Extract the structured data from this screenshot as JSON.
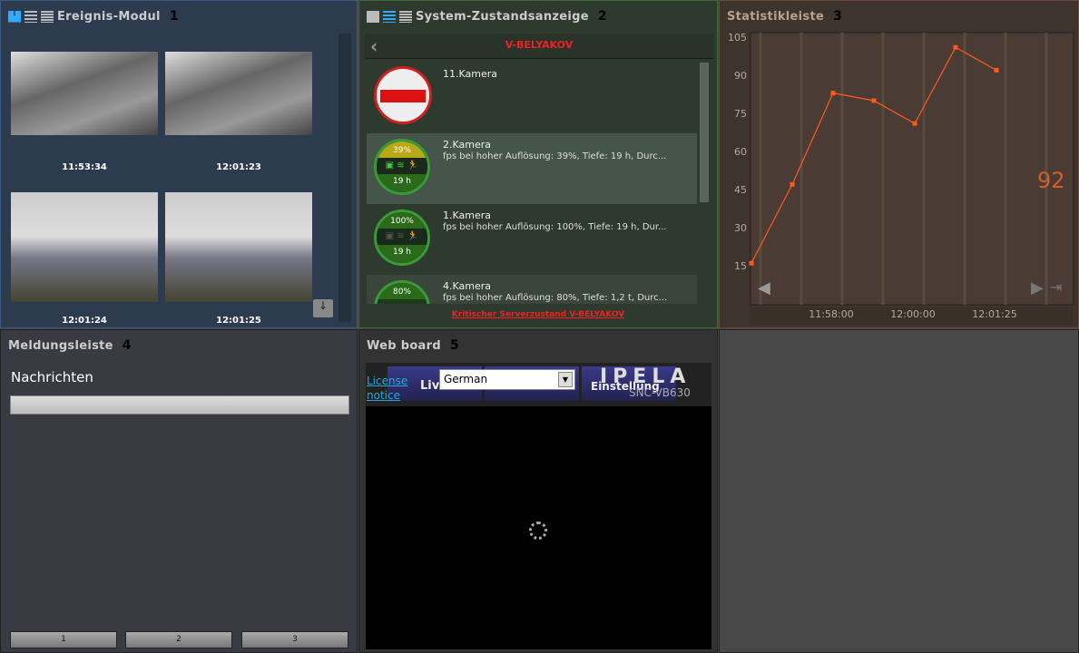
{
  "panels": {
    "events": {
      "title": "Ereignis-Modul",
      "number": "1",
      "timestamps": [
        "11:53:34",
        "12:01:23",
        "12:01:24",
        "12:01:25"
      ]
    },
    "status": {
      "title": "System-Zustandsanzeige",
      "number": "2",
      "server": "V-BELYAKOV",
      "cameras": [
        {
          "name": "11.Kamera",
          "desc": "",
          "state": "offline"
        },
        {
          "name": "2.Kamera",
          "desc": "fps bei hoher Auflösung: 39%, Tiefe: 19 h, Durc...",
          "top": "39%",
          "bottom": "19 h",
          "state": "warning"
        },
        {
          "name": "1.Kamera",
          "desc": "fps bei hoher Auflösung: 100%, Tiefe: 19 h, Dur...",
          "top": "100%",
          "bottom": "19 h",
          "state": "ok"
        },
        {
          "name": "4.Kamera",
          "desc": "fps bei hoher Auflösung: 80%, Tiefe: 1,2 t, Durc...",
          "top": "80%",
          "bottom": "",
          "state": "ok"
        }
      ],
      "footer_link": "Kritischer Serverzustand V-BELYAKOV"
    },
    "stats": {
      "title": "Statistikleiste",
      "number": "3",
      "current_value": "92"
    },
    "messages": {
      "title": "Meldungsleiste",
      "number": "4",
      "heading": "Nachrichten",
      "buttons": [
        "1",
        "2",
        "3"
      ]
    },
    "web": {
      "title": "Web board",
      "number": "5",
      "license": "License notice",
      "license1": "License",
      "license2": "notice",
      "tabs": [
        "Live",
        "Einstellung"
      ],
      "language": "German",
      "brand": "IPELA",
      "model": "SNC-VB630"
    }
  },
  "chart_data": {
    "type": "line",
    "x": [
      "11:56:00",
      "11:57:00",
      "11:58:00",
      "11:59:00",
      "12:00:00",
      "12:01:00",
      "12:02:00"
    ],
    "values": [
      16,
      47,
      83,
      80,
      71,
      101,
      92
    ],
    "ylim": [
      15,
      105
    ],
    "yticks": [
      15,
      30,
      45,
      60,
      75,
      90,
      105
    ],
    "xticks": [
      "11:58:00",
      "12:00:00",
      "12:01:25"
    ],
    "grid": true,
    "color": "#ff5a1a"
  }
}
